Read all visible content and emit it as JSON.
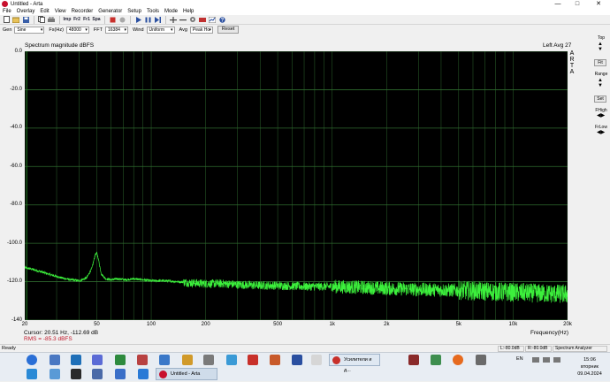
{
  "window": {
    "title": "Untitled - Arta",
    "min_glyph": "—",
    "max_glyph": "□",
    "close_glyph": "✕"
  },
  "menu": [
    "File",
    "Overlay",
    "Edit",
    "View",
    "Recorder",
    "Generator",
    "Setup",
    "Tools",
    "Mode",
    "Help"
  ],
  "toolbar_labels": {
    "imp": "Imp",
    "fr2": "Fr2",
    "fr1": "Fr1",
    "spa": "Spa"
  },
  "generator_bar": {
    "gen_label": "Gen",
    "gen_value": "Sine",
    "fs_label": "Fs(Hz)",
    "fs_value": "48000",
    "fft_label": "FFT",
    "fft_value": "16384",
    "wind_label": "Wind",
    "wind_value": "Uniform",
    "avg_label": "Avg",
    "avg_value": "Peak Ho",
    "reset_label": "Reset"
  },
  "chart_header": {
    "title": "Spectrum magnitude dBFS",
    "channel_info": "Left  Avg 27",
    "brand_vertical": "ARTA"
  },
  "readout": {
    "cursor": "Cursor: 20.51 Hz, -112.69 dB",
    "rms": "RMS = -85.3 dBFS"
  },
  "right_panel": {
    "top_label": "Top",
    "fit_label": "Fit",
    "range_label": "Range",
    "set_label": "Set",
    "fhigh_label": "FHigh",
    "flow_label": "FrLow",
    "up": "▲",
    "down": "▼"
  },
  "status": {
    "left": "Ready",
    "l_level": "L:-80.0dB",
    "r_level": "R:-80.0dB",
    "mode": "Spectrum Analyzer"
  },
  "taskbar": {
    "active_task": "Untitled - Arta",
    "second_task": "Усилители и д...",
    "lang": "EN",
    "time": "15:06",
    "weekday": "вторник",
    "date": "09.04.2024"
  },
  "colors": {
    "trace": "#3cf03c",
    "grid": "#2f6b2f",
    "plot_bg": "#000000",
    "rms_text": "#c0182a",
    "cursor_line": "#1f7a1f"
  },
  "chart_data": {
    "type": "line",
    "title": "Spectrum magnitude dBFS",
    "xlabel": "Frequency(Hz)",
    "ylabel": "",
    "x_scale": "log",
    "xlim": [
      20,
      20000
    ],
    "ylim": [
      -140,
      0
    ],
    "y_ticks": [
      0.0,
      -20.0,
      -40.0,
      -60.0,
      -80.0,
      -100.0,
      -120.0,
      -140.0
    ],
    "y_tick_labels": [
      "0.0",
      "-20.0",
      "-40.0",
      "-60.0",
      "-80.0",
      "-100.0",
      "-120.0",
      "-140"
    ],
    "x_ticks": [
      20,
      50,
      100,
      200,
      500,
      1000,
      2000,
      5000,
      10000,
      20000
    ],
    "x_tick_labels": [
      "20",
      "50",
      "100",
      "200",
      "500",
      "1k",
      "2k",
      "5k",
      "10k",
      "20k"
    ],
    "grid": true,
    "series": [
      {
        "color": "#3cf03c",
        "x": [
          20,
          22,
          25,
          28,
          32,
          36,
          40,
          44,
          47,
          49,
          50,
          51,
          53,
          56,
          60,
          66,
          72,
          80,
          90,
          100,
          120,
          140,
          160,
          200,
          250,
          300,
          400,
          500,
          700,
          1000,
          1500,
          2000,
          3000,
          5000,
          7000,
          10000,
          14000,
          20000
        ],
        "y": [
          -112.7,
          -113.5,
          -115,
          -116.5,
          -118,
          -119,
          -119.5,
          -118,
          -113,
          -106,
          -105,
          -108,
          -116,
          -118.5,
          -119,
          -118.5,
          -119,
          -118.5,
          -119,
          -119.5,
          -119.5,
          -120,
          -120.5,
          -121,
          -121,
          -121.5,
          -122,
          -122,
          -122.5,
          -122.5,
          -123,
          -123.5,
          -124,
          -124.5,
          -125,
          -125.5,
          -126,
          -126.5
        ]
      }
    ]
  }
}
